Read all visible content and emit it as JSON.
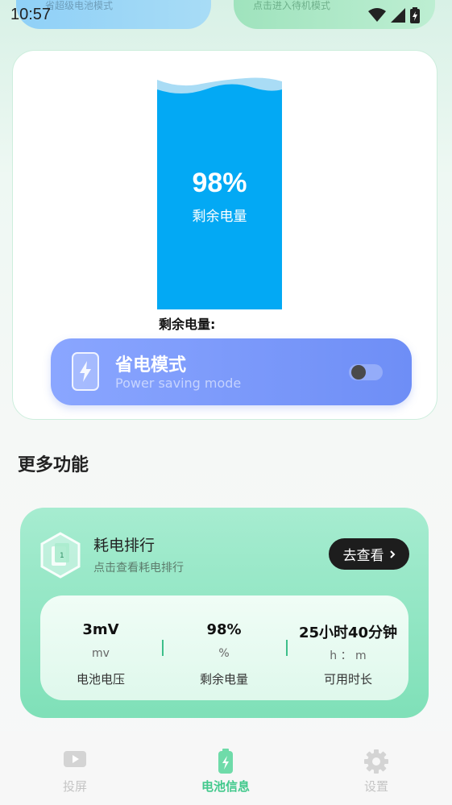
{
  "status_bar": {
    "time": "10:57"
  },
  "top_cards": {
    "left_text": "省超级电池模式",
    "right_text": "点击进入待机模式"
  },
  "battery": {
    "percent": "98%",
    "percent_label": "剩余电量",
    "remaining_label": "剩余电量:",
    "fill_fraction": 0.98,
    "fill_color": "#03a9f4"
  },
  "power_saving": {
    "title": "省电模式",
    "subtitle": "Power saving mode",
    "enabled": false
  },
  "section": {
    "title": "更多功能"
  },
  "feature": {
    "title": "耗电排行",
    "subtitle": "点击查看耗电排行",
    "button_label": "去查看",
    "stats": [
      {
        "value": "3mV",
        "unit": "mv",
        "label": "电池电压"
      },
      {
        "value": "98%",
        "unit": "%",
        "label": "剩余电量"
      },
      {
        "value": "25小时40分钟",
        "unit": "h ： m",
        "label": "可用时长"
      }
    ]
  },
  "bottom_nav": {
    "items": [
      {
        "label": "投屏",
        "icon": "play-screen-icon",
        "active": false
      },
      {
        "label": "电池信息",
        "icon": "battery-icon",
        "active": true
      },
      {
        "label": "设置",
        "icon": "gear-icon",
        "active": false
      }
    ]
  },
  "colors": {
    "accent_green": "#43c98d",
    "power_save_gradient": [
      "#8aa6ff",
      "#6e8ef6"
    ],
    "feature_card": "#7fe0b8"
  }
}
